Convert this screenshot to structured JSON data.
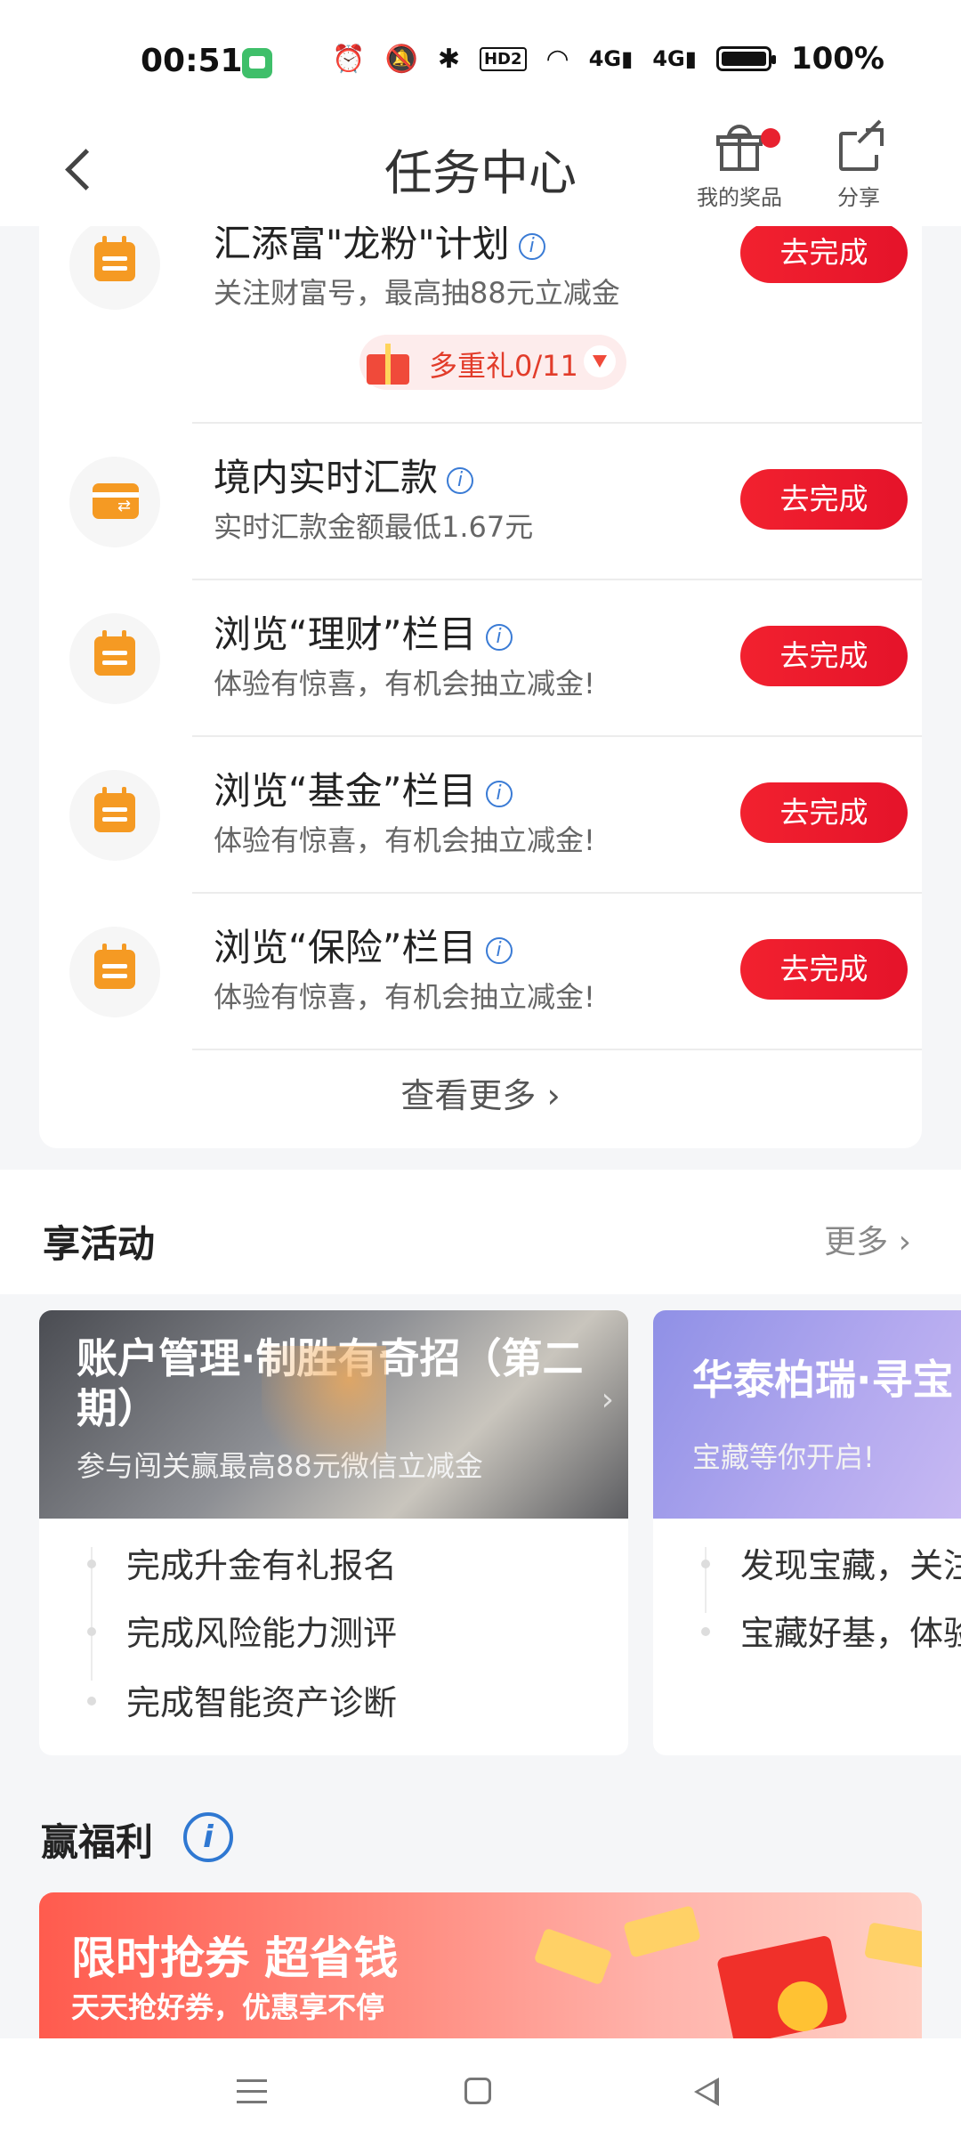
{
  "status_bar": {
    "time": "00:51",
    "hd": "HD2",
    "net1": "4G",
    "net2": "4G",
    "battery": "100%"
  },
  "header": {
    "title": "任务中心",
    "my_prizes": "我的奖品",
    "share": "分享"
  },
  "tasks": [
    {
      "title": "汇添富\"龙粉\"计划",
      "desc": "关注财富号，最高抽88元立减金",
      "button": "去完成",
      "icon": "calendar-icon"
    },
    {
      "title": "境内实时汇款",
      "desc": "实时汇款金额最低1.67元",
      "button": "去完成",
      "icon": "card-transfer-icon"
    },
    {
      "title": "浏览“理财”栏目",
      "desc": "体验有惊喜，有机会抽立减金!",
      "button": "去完成",
      "icon": "calendar-icon"
    },
    {
      "title": "浏览“基金”栏目",
      "desc": "体验有惊喜，有机会抽立减金!",
      "button": "去完成",
      "icon": "calendar-icon"
    },
    {
      "title": "浏览“保险”栏目",
      "desc": "体验有惊喜，有机会抽立减金!",
      "button": "去完成",
      "icon": "calendar-icon"
    }
  ],
  "multi_gift": "多重礼0/11",
  "see_more": "查看更多",
  "activities": {
    "title": "享活动",
    "more": "更多",
    "cards": [
      {
        "title": "账户管理·制胜有奇招（第二期）",
        "subtitle": "参与闯关赢最高88元微信立减金",
        "items": [
          "完成升金有礼报名",
          "完成风险能力测评",
          "完成智能资产诊断"
        ]
      },
      {
        "title": "华泰柏瑞·寻宝",
        "subtitle": "宝藏等你开启!",
        "items": [
          "发现宝藏，关注",
          "宝藏好基，体验"
        ]
      }
    ]
  },
  "welfare": {
    "title": "赢福利",
    "banner_title": "限时抢券 超省钱",
    "banner_sub": "天天抢好券，优惠享不停"
  },
  "colors": {
    "accent_red": "#e8212f",
    "task_icon_orange": "#f59a23",
    "info_blue": "#3a7bd5"
  }
}
